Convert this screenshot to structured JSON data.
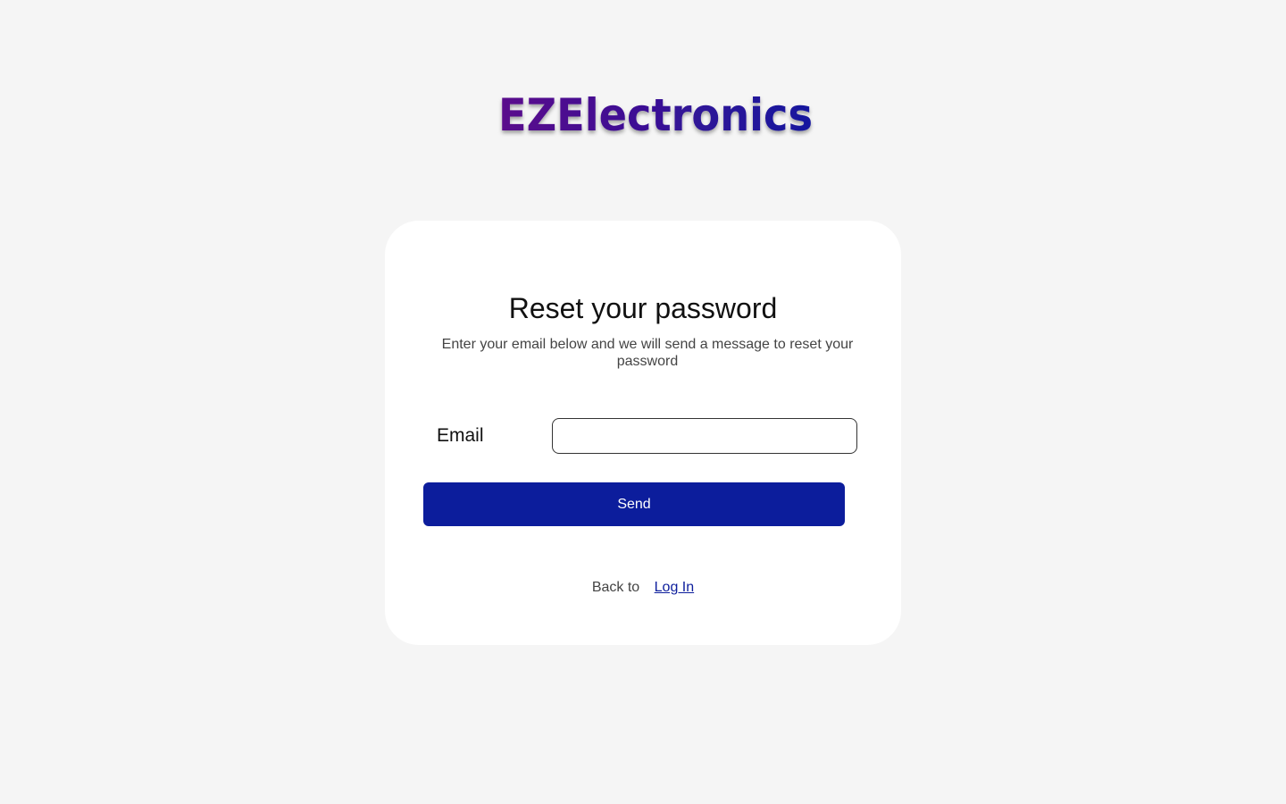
{
  "brand": {
    "logo_text": "EZElectronics",
    "gradient_start": "#5b0a8c",
    "gradient_end": "#16189e"
  },
  "reset_form": {
    "title": "Reset your password",
    "subtitle": "Enter your email below and we will send a message to reset your password",
    "email_label": "Email",
    "email_value": "",
    "email_placeholder": "",
    "send_label": "Send",
    "back_text": "Back to",
    "login_link_label": "Log In"
  },
  "colors": {
    "page_background": "#f5f5f5",
    "card_background": "#ffffff",
    "primary": "#0c1d9c"
  }
}
